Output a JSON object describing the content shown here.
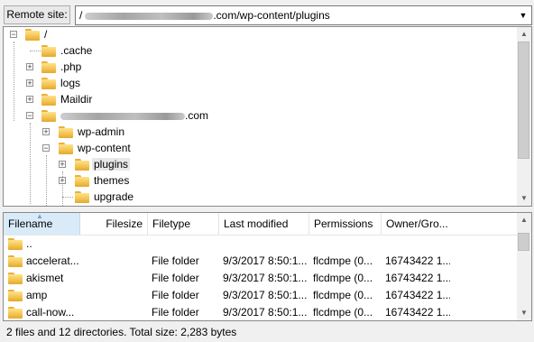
{
  "remote_site": {
    "label": "Remote site:",
    "path_prefix": "/",
    "path_suffix": ".com/wp-content/plugins"
  },
  "tree": {
    "items": [
      {
        "label": "/",
        "expander": "−"
      },
      {
        "label": ".cache",
        "expander": ""
      },
      {
        "label": ".php",
        "expander": "+"
      },
      {
        "label": "logs",
        "expander": "+"
      },
      {
        "label": "Maildir",
        "expander": "+"
      },
      {
        "label": ".com",
        "expander": "−"
      },
      {
        "label": "wp-admin",
        "expander": "+"
      },
      {
        "label": "wp-content",
        "expander": "−"
      },
      {
        "label": "plugins",
        "expander": "+"
      },
      {
        "label": "themes",
        "expander": "+"
      },
      {
        "label": "upgrade",
        "expander": ""
      }
    ]
  },
  "list": {
    "columns": [
      "Filename",
      "Filesize",
      "Filetype",
      "Last modified",
      "Permissions",
      "Owner/Gro..."
    ],
    "rows": [
      {
        "name": "..",
        "size": "",
        "type": "",
        "modified": "",
        "perms": "",
        "owner": ""
      },
      {
        "name": "accelerat...",
        "size": "",
        "type": "File folder",
        "modified": "9/3/2017 8:50:1...",
        "perms": "flcdmpe (0...",
        "owner": "16743422 1..."
      },
      {
        "name": "akismet",
        "size": "",
        "type": "File folder",
        "modified": "9/3/2017 8:50:1...",
        "perms": "flcdmpe (0...",
        "owner": "16743422 1..."
      },
      {
        "name": "amp",
        "size": "",
        "type": "File folder",
        "modified": "9/3/2017 8:50:1...",
        "perms": "flcdmpe (0...",
        "owner": "16743422 1..."
      },
      {
        "name": "call-now...",
        "size": "",
        "type": "File folder",
        "modified": "9/3/2017 8:50:1...",
        "perms": "flcdmpe (0...",
        "owner": "16743422 1..."
      }
    ]
  },
  "status": {
    "text": "2 files and 12 directories. Total size: 2,283 bytes"
  },
  "colors": {
    "selection": "#d9ebf9",
    "folder": "#f2c24f",
    "scroll_thumb": "#cdcdcd"
  }
}
